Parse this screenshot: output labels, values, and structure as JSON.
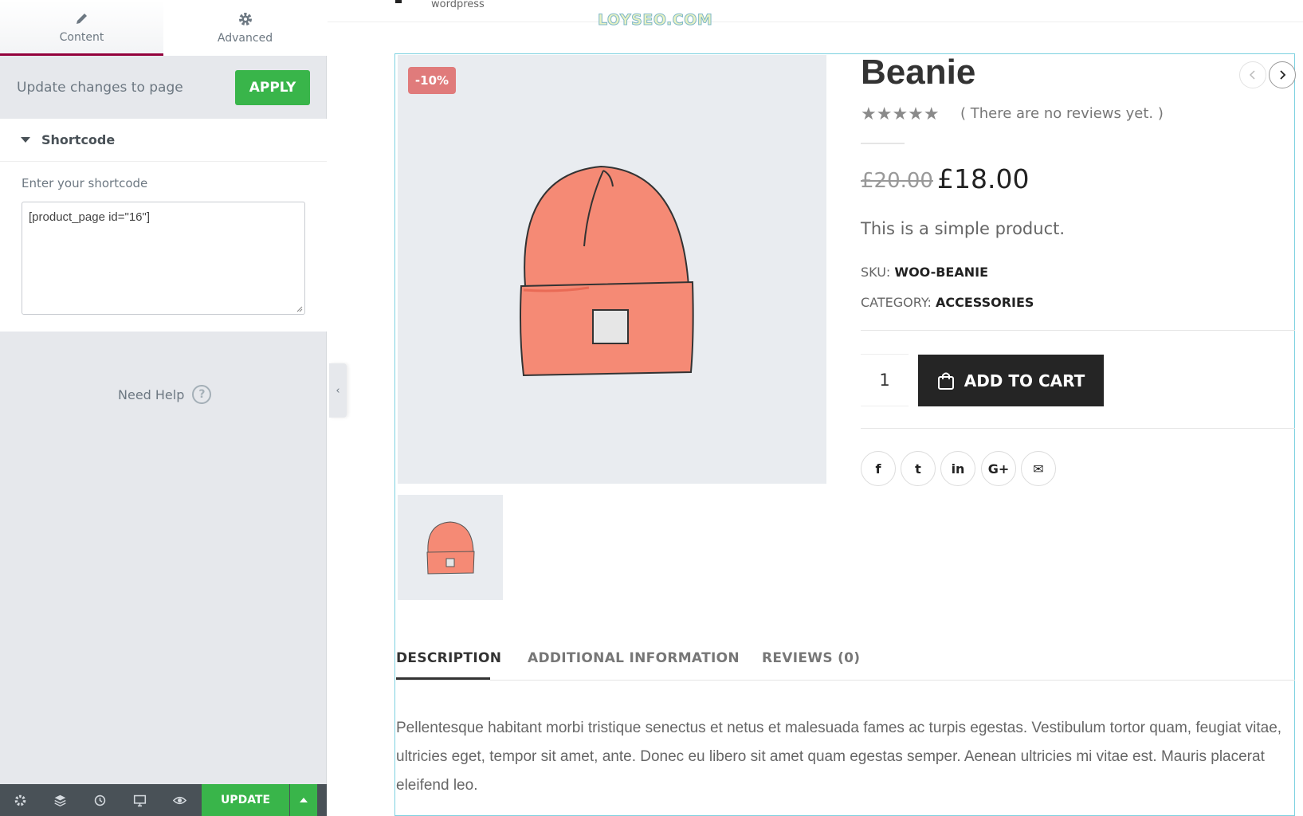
{
  "editor": {
    "tabs": [
      {
        "label": "Content",
        "icon": "pencil-icon",
        "active": true
      },
      {
        "label": "Advanced",
        "icon": "gear-icon",
        "active": false
      }
    ],
    "apply_bar": {
      "text": "Update changes to page",
      "button": "APPLY"
    },
    "section": {
      "title": "Shortcode",
      "field_label": "Enter your shortcode",
      "field_value": "[product_page id=\"16\"]"
    },
    "help": {
      "label": "Need Help",
      "icon": "?"
    },
    "collapse_icon": "‹",
    "bottom_bar": {
      "update_label": "UPDATE",
      "icons": [
        "settings-icon",
        "layers-icon",
        "history-icon",
        "responsive-icon",
        "preview-icon"
      ]
    },
    "colors": {
      "accent_green": "#39b54a",
      "tab_active": "#93003c",
      "bottom_bar": "#495157"
    }
  },
  "site": {
    "header_text": "wordpress",
    "watermark": "LOYSEO.COM"
  },
  "product": {
    "sale_badge": "-10%",
    "title": "Beanie",
    "rating_stars": "★★★★★",
    "reviews_note": "( There are no reviews yet. )",
    "price_old": "£20.00",
    "price_new": "£18.00",
    "short_description": "This is a simple product.",
    "sku_label": "SKU:",
    "sku_value": "WOO-BEANIE",
    "category_label": "CATEGORY:",
    "category_value": "ACCESSORIES",
    "quantity": "1",
    "add_to_cart": "ADD TO CART",
    "share_icons": [
      "f",
      "t",
      "in",
      "G+",
      "✉"
    ],
    "tabs": [
      {
        "label": "DESCRIPTION",
        "active": true
      },
      {
        "label": "ADDITIONAL INFORMATION",
        "active": false
      },
      {
        "label": "REVIEWS (0)",
        "active": false
      }
    ],
    "description": "Pellentesque habitant morbi tristique senectus et netus et malesuada fames ac turpis egestas. Vestibulum tortor quam, feugiat vitae, ultricies eget, tempor sit amet, ante. Donec eu libero sit amet quam egestas semper. Aenean ultricies mi vitae est. Mauris placerat eleifend leo."
  }
}
